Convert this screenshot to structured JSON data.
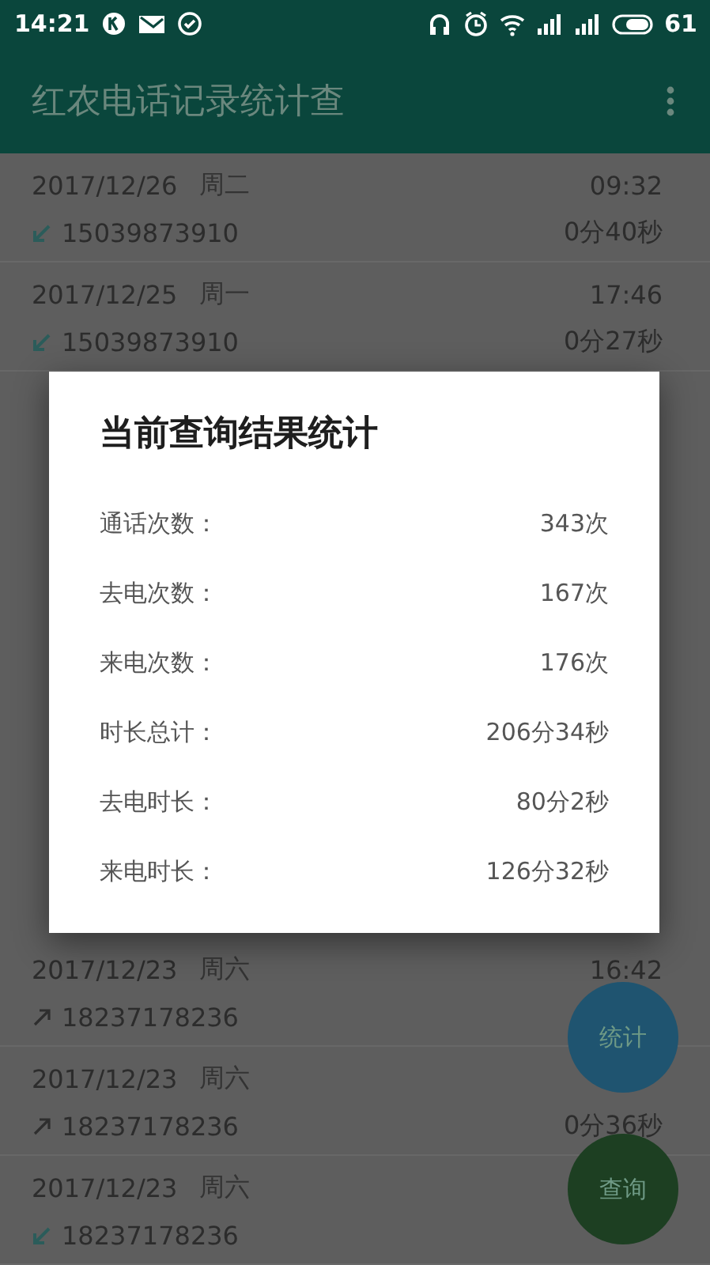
{
  "status_bar": {
    "time": "14:21",
    "battery": "61"
  },
  "app_bar": {
    "title": "红农电话记录统计查"
  },
  "calls_above": [
    {
      "date": "2017/12/26",
      "weekday": "周二",
      "time": "09:32",
      "kind": "incoming",
      "number": "15039873910",
      "duration": "0分40秒"
    },
    {
      "date": "2017/12/25",
      "weekday": "周一",
      "time": "17:46",
      "kind": "incoming",
      "number": "15039873910",
      "duration": "0分27秒"
    }
  ],
  "calls_below": [
    {
      "date": "2017/12/23",
      "weekday": "周六",
      "time": "16:42",
      "kind": "outgoing",
      "number": "18237178236"
    },
    {
      "date": "2017/12/23",
      "weekday": "周六",
      "kind": "outgoing",
      "number": "18237178236",
      "duration": "0分36秒"
    },
    {
      "date": "2017/12/23",
      "weekday": "周六",
      "kind": "incoming",
      "number": "18237178236"
    }
  ],
  "dialog": {
    "title": "当前查询结果统计",
    "rows": [
      {
        "label": "通话次数：",
        "value": "343次"
      },
      {
        "label": "去电次数：",
        "value": "167次"
      },
      {
        "label": "来电次数：",
        "value": "176次"
      },
      {
        "label": "时长总计：",
        "value": "206分34秒"
      },
      {
        "label": "去电时长：",
        "value": "80分2秒"
      },
      {
        "label": "来电时长：",
        "value": "126分32秒"
      }
    ]
  },
  "fabs": [
    {
      "label": "统计",
      "color": "#1f5470"
    },
    {
      "label": "查询",
      "color": "#1d3f22"
    }
  ]
}
